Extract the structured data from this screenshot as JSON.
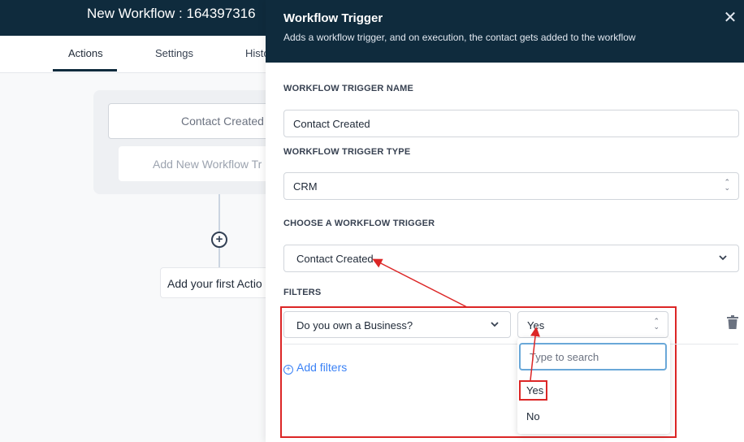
{
  "app": {
    "workflow_title": "New Workflow : 164397316",
    "tabs": [
      {
        "label": "Actions"
      },
      {
        "label": "Settings"
      },
      {
        "label": "Histo"
      }
    ],
    "canvas": {
      "trigger_label": "Contact Created",
      "add_trigger_label": "Add New Workflow Tr",
      "add_action_label": "Add your first Actio"
    }
  },
  "panel": {
    "title": "Workflow Trigger",
    "subtitle": "Adds a workflow trigger, and on execution, the contact gets added to the workflow",
    "trigger_name": {
      "label": "WORKFLOW TRIGGER NAME",
      "value": "Contact Created"
    },
    "trigger_type": {
      "label": "WORKFLOW TRIGGER TYPE",
      "value": "CRM"
    },
    "choose_trigger": {
      "label": "CHOOSE A WORKFLOW TRIGGER",
      "value": "Contact Created"
    },
    "filters": {
      "label": "FILTERS",
      "field": "Do you own a Business?",
      "value": "Yes",
      "search_placeholder": "Type to search",
      "options": [
        "Yes",
        "No"
      ],
      "add_filters_label": "Add filters"
    }
  },
  "colors": {
    "header_bg": "#0f2b3d",
    "annotation_red": "#dc2626",
    "link_blue": "#3b82f6"
  }
}
